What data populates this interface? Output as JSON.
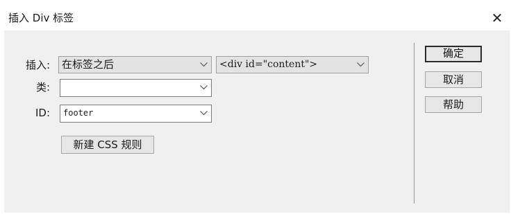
{
  "dialog": {
    "title": "插入 Div 标签",
    "close_glyph": "✕"
  },
  "insert": {
    "label": "插入:",
    "position_value": "在标签之后",
    "target_value": "<div id=\"content\">"
  },
  "class_field": {
    "label": "类:",
    "value": ""
  },
  "id_field": {
    "label": "ID:",
    "value": "footer"
  },
  "buttons": {
    "new_css_rule": "新建 CSS 规则",
    "ok": "确定",
    "cancel": "取消",
    "help": "帮助"
  },
  "icons": {
    "close": "close-icon",
    "dropdown": "chevron-down-icon"
  }
}
